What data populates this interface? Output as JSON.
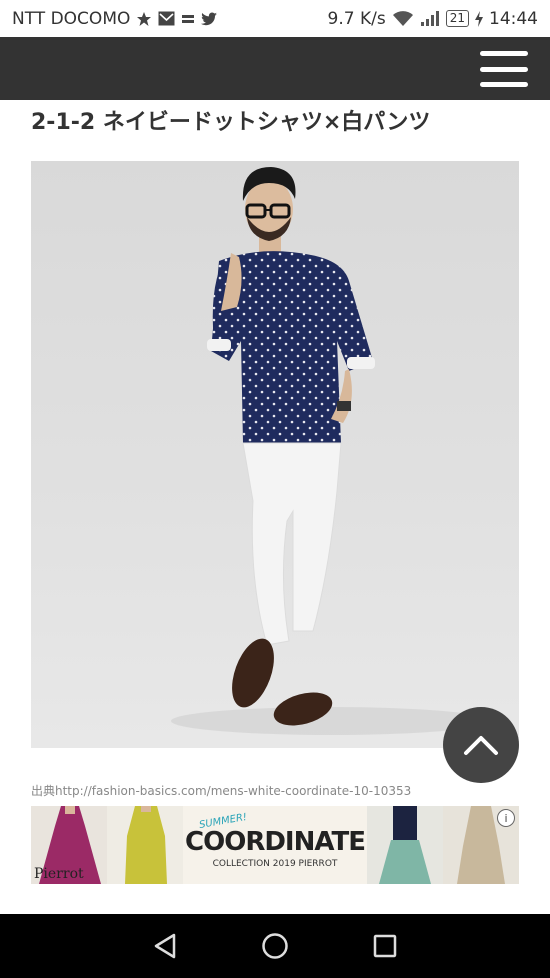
{
  "status_bar": {
    "carrier": "NTT DOCOMO",
    "network_speed": "9.7 K/s",
    "battery": "21",
    "time": "14:44"
  },
  "article": {
    "section_title": "2-1-2 ネイビードットシャツ×白パンツ",
    "photo_source": "出典http://fashion-basics.com/mens-white-coordinate-10-10353"
  },
  "ad": {
    "summer": "SUMMER!",
    "headline": "COORDINATE",
    "collection": "COLLECTION 2019 PIERROT",
    "brand": "Pierrot",
    "info_symbol": "i"
  },
  "colors": {
    "header_bg": "#333333",
    "shirt_navy": "#1f2b5e",
    "scroll_button": "#444444"
  }
}
